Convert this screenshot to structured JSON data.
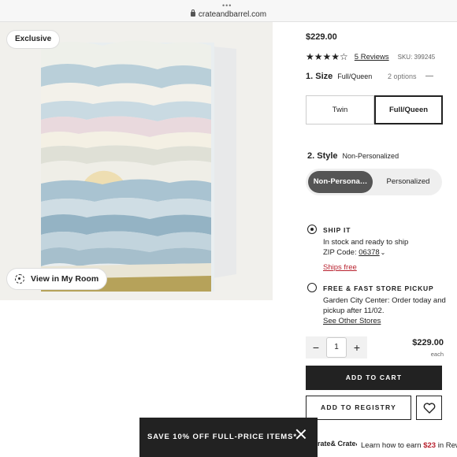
{
  "browser": {
    "menu_dots": "•••",
    "url": "crateandbarrel.com"
  },
  "image": {
    "badge": "Exclusive",
    "room_button": "View in My Room"
  },
  "product": {
    "price": "$229.00",
    "stars": "★★★★☆",
    "rating": 4,
    "reviews": "5 Reviews",
    "sku": "SKU: 399245"
  },
  "size": {
    "title": "1. Size",
    "value": "Full/Queen",
    "options_count": "2 options",
    "options": [
      "Twin",
      "Full/Queen"
    ],
    "selected": "Full/Queen"
  },
  "style": {
    "title": "2. Style",
    "value": "Non-Personalized",
    "options": [
      "Non-Persona…",
      "Personalized"
    ]
  },
  "shipping": {
    "ship_title": "SHIP IT",
    "ship_line1": "In stock and ready to ship",
    "zip_label": "ZIP Code:",
    "zip": "06378",
    "ships_free": "Ships free",
    "pickup_title": "FREE & FAST STORE PICKUP",
    "pickup_line1": "Garden City Center: Order today and",
    "pickup_line2": "pickup after 11/02.",
    "other_stores": "See Other Stores"
  },
  "quantity": {
    "minus": "−",
    "value": "1",
    "plus": "+",
    "price": "$229.00",
    "unit": "each"
  },
  "actions": {
    "add_to_cart": "ADD TO CART",
    "add_to_registry": "ADD TO REGISTRY"
  },
  "promo": {
    "text": "SAVE 10% OFF FULL-PRICE ITEMS*"
  },
  "footer": {
    "card_text": "rate& Crate&",
    "learn_pre": "Learn how to earn ",
    "learn_amount": "$23",
    "learn_post": " in Rew"
  },
  "colors": {
    "accent_red": "#b8222f",
    "dark": "#222222",
    "quilt_blue": "#a9c3d1",
    "sun": "#e6bf5a",
    "ground": "#b6a25a"
  }
}
